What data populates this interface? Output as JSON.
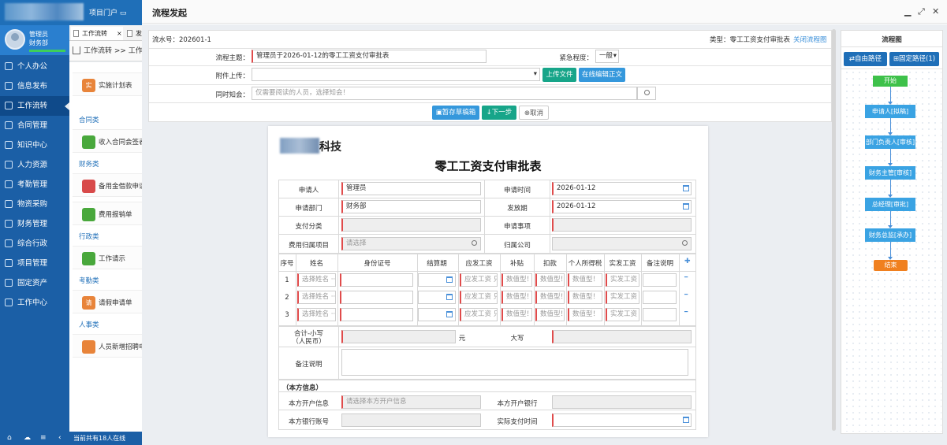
{
  "app": {
    "portal_label": "项目门户",
    "user_role": "管理员",
    "user_dept": "财务部",
    "online_text": "当前共有18人在线"
  },
  "nav": [
    {
      "label": "个人办公",
      "icon": "person-icon"
    },
    {
      "label": "信息发布",
      "icon": "news-icon"
    },
    {
      "label": "工作流转",
      "icon": "workflow-icon",
      "active": true
    },
    {
      "label": "合同管理",
      "icon": "contract-icon"
    },
    {
      "label": "知识中心",
      "icon": "knowledge-icon"
    },
    {
      "label": "人力资源",
      "icon": "hr-icon"
    },
    {
      "label": "考勤管理",
      "icon": "attendance-icon"
    },
    {
      "label": "物资采购",
      "icon": "purchase-icon"
    },
    {
      "label": "财务管理",
      "icon": "finance-icon"
    },
    {
      "label": "综合行政",
      "icon": "admin-icon"
    },
    {
      "label": "项目管理",
      "icon": "project-icon"
    },
    {
      "label": "固定资产",
      "icon": "asset-icon"
    },
    {
      "label": "工作中心",
      "icon": "work-center-icon"
    }
  ],
  "tabs": [
    {
      "label": "工作流转"
    },
    {
      "label": "发起"
    }
  ],
  "breadcrumb": "工作流转 >> 工作流",
  "list": {
    "items": [
      {
        "badge": "实",
        "label": "实施计划表",
        "color": "#e8843a"
      },
      {
        "section": "合同类"
      },
      {
        "badge": "",
        "label": "收入合同会签表",
        "color": "#49a83c"
      },
      {
        "section": "财务类"
      },
      {
        "badge": "",
        "label": "备用金借款申请",
        "color": "#d84a4a"
      },
      {
        "badge": "",
        "label": "费用报销单",
        "color": "#49a83c"
      },
      {
        "section": "行政类"
      },
      {
        "badge": "",
        "label": "工作请示",
        "color": "#49a83c"
      },
      {
        "section": "考勤类"
      },
      {
        "badge": "请",
        "label": "请假申请单",
        "color": "#e8843a"
      },
      {
        "section": "人事类"
      },
      {
        "badge": "",
        "label": "人员新增招聘申",
        "color": "#e8843a"
      }
    ]
  },
  "modal": {
    "title": "流程发起"
  },
  "form": {
    "serial_label": "流水号：",
    "serial": "202601-1",
    "type_label": "类型：",
    "type": "零工工资支付审批表",
    "close_flow": "关闭流程图",
    "subject_label": "流程主题：",
    "subject": "管理员于2026-01-12的零工工资支付审批表",
    "urgency_label": "紧急程度：",
    "urgency": "一般",
    "attach_label": "附件上传：",
    "upload_btn": "上传文件",
    "edit_btn": "在线编辑正文",
    "notify_label": "同时知会：",
    "notify_placeholder": "仅需要阅读的人员，选择知会！",
    "save_draft": "暂存草稿箱",
    "next_step": "下一步",
    "cancel": "取消"
  },
  "paper": {
    "company": "科技",
    "title": "零工工资支付审批表",
    "fields": {
      "applicant_label": "申请人",
      "applicant": "管理员",
      "apply_time_label": "申请时间",
      "apply_time": "2026-01-12",
      "dept_label": "申请部门",
      "dept": "财务部",
      "pay_date_label": "发放期",
      "pay_date": "2026-01-12",
      "pay_cat_label": "支付分类",
      "apply_item_label": "申请事项",
      "cost_proj_label": "费用归属项目",
      "cost_proj_ph": "请选择",
      "company_label": "归属公司"
    },
    "columns": [
      "序号",
      "姓名",
      "身份证号",
      "结算期",
      "应发工资",
      "补贴",
      "扣款",
      "个人所得税",
      "实发工资",
      "备注说明"
    ],
    "rows": [
      {
        "no": "1",
        "name_ph": "选择姓名 ···",
        "pay_ph": "应发工资 只",
        "num_ph": "数值型！",
        "net_ph": "实发工资 只"
      },
      {
        "no": "2",
        "name_ph": "选择姓名 ···",
        "pay_ph": "应发工资 只",
        "num_ph": "数值型！",
        "net_ph": "实发工资 只"
      },
      {
        "no": "3",
        "name_ph": "选择姓名 ···",
        "pay_ph": "应发工资 只",
        "num_ph": "数值型！",
        "net_ph": "实发工资 只"
      }
    ],
    "total_label": "合计-小写",
    "total_sub": "（人民币）",
    "yuan": "元",
    "daxie_label": "大写",
    "remark_label": "备注说明",
    "own_info": "（本方信息）",
    "account_label": "本方开户信息",
    "account_ph": "请选择本方开户信息",
    "bank_label": "本方开户银行",
    "bank_no_label": "本方银行账号",
    "actual_time_label": "实际支付时间"
  },
  "flowchart": {
    "title": "流程图",
    "free_path": "自由路径",
    "fixed_path": "固定路径(1)",
    "nodes": [
      "开始",
      "申请人[拟稿]",
      "部门负责人[审核]",
      "财务主管[审核]",
      "总经理[审批]",
      "财务总监[承办]",
      "结束"
    ]
  }
}
